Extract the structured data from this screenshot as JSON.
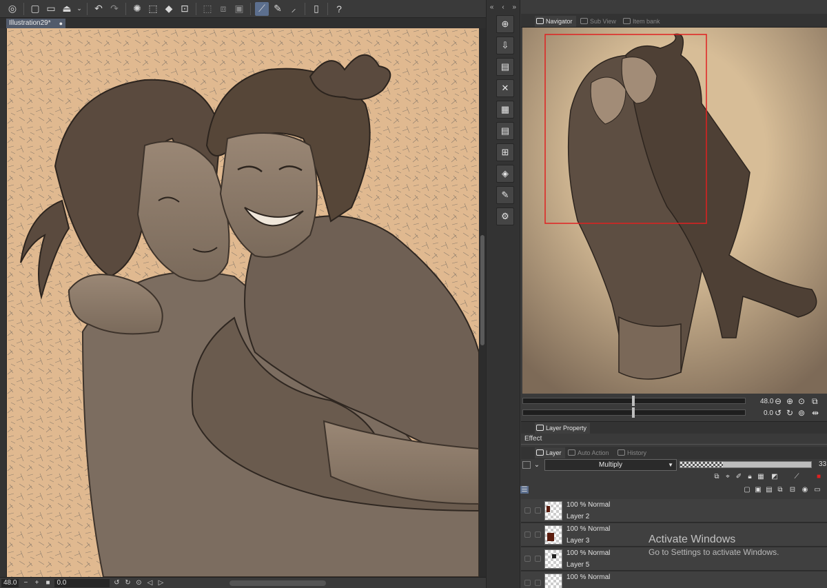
{
  "window": {
    "document_tab": "Illustration29*",
    "tab_modified_marker": "●"
  },
  "toolbar": {
    "icons": [
      "app-logo-icon",
      "new-file-icon",
      "open-file-icon",
      "save-icon",
      "dropdown-icon",
      "undo-icon",
      "redo-icon",
      "loading-icon",
      "clear-icon",
      "fill-icon",
      "transform-icon",
      "deselect-icon",
      "invert-selection-icon",
      "show-selection-icon",
      "ruler-snap-icon",
      "pen-icon",
      "brush-icon",
      "device-icon",
      "help-icon"
    ]
  },
  "canvas_status": {
    "zoom": "48.0",
    "rotation": "0.0",
    "zoom_minus": "−",
    "zoom_plus": "+",
    "fit": "■"
  },
  "right_tabs": {
    "navigator": "Navigator",
    "sub_view": "Sub View",
    "item_bank": "Item bank"
  },
  "navigator": {
    "zoom_value": "48.0",
    "rotate_value": "0.0"
  },
  "layer_property": {
    "tab": "Layer Property",
    "effect_label": "Effect"
  },
  "layer_panel": {
    "tabs": {
      "layer": "Layer",
      "auto_action": "Auto Action",
      "history": "History"
    },
    "blend_mode": "Multiply",
    "opacity": "33",
    "layers": [
      {
        "mode": "100 % Normal",
        "name": "Layer 2"
      },
      {
        "mode": "100 % Normal",
        "name": "Layer 3"
      },
      {
        "mode": "100 % Normal",
        "name": "Layer 5"
      },
      {
        "mode": "100 % Normal",
        "name": ""
      }
    ]
  },
  "os_overlay": {
    "activate_title": "Activate Windows",
    "activate_sub": "Go to Settings to activate Windows."
  },
  "colors": {
    "canvas_bg": "#e0b990",
    "sketch_dark": "#4a3d33",
    "navigator_frame": "#e02020",
    "panel_bg": "#3a3a3a"
  }
}
